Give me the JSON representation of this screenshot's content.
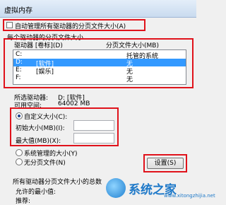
{
  "window": {
    "title": "虚拟内存"
  },
  "auto_manage": {
    "label": "自动管理所有驱动器的分页文件大小(A)",
    "checked": false
  },
  "paging_group": {
    "label": "每个驱动器的分页文件大小"
  },
  "drive_list": {
    "col_drive": "驱动器 [卷标](D)",
    "col_size": "分页文件大小(MB)",
    "rows": [
      {
        "drive": "C:",
        "label": "",
        "size": "托管的系统",
        "selected": false
      },
      {
        "drive": "D:",
        "label": "[软件]",
        "size": "无",
        "selected": true
      },
      {
        "drive": "E:",
        "label": "[娱乐]",
        "size": "无",
        "selected": false
      },
      {
        "drive": "F:",
        "label": "",
        "size": "无",
        "selected": false
      }
    ]
  },
  "selected_drive": {
    "label": "所选驱动器:",
    "value": "D: [软件]"
  },
  "free_space": {
    "label": "可用空间:",
    "value": "64002 MB"
  },
  "custom_size": {
    "label": "自定义大小(C):",
    "selected": true,
    "initial_label": "初始大小(MB)(I):",
    "initial_value": "",
    "max_label": "最大值(MB)(X):",
    "max_value": ""
  },
  "system_managed": {
    "label": "系统管理的大小(Y)",
    "selected": false
  },
  "no_paging": {
    "label": "无分页文件(N)",
    "selected": false
  },
  "set_button": {
    "label": "设置(S)"
  },
  "totals": {
    "group_label": "所有驱动器分页文件大小的总数",
    "min_allowed_label": "允许的最小值:",
    "recommended_label": "推荐:"
  },
  "watermark": {
    "text": "系统之家",
    "url": "www.xitongzhijia.net"
  },
  "colors": {
    "highlight_box": "#e0121b",
    "selection": "#3399ff"
  }
}
